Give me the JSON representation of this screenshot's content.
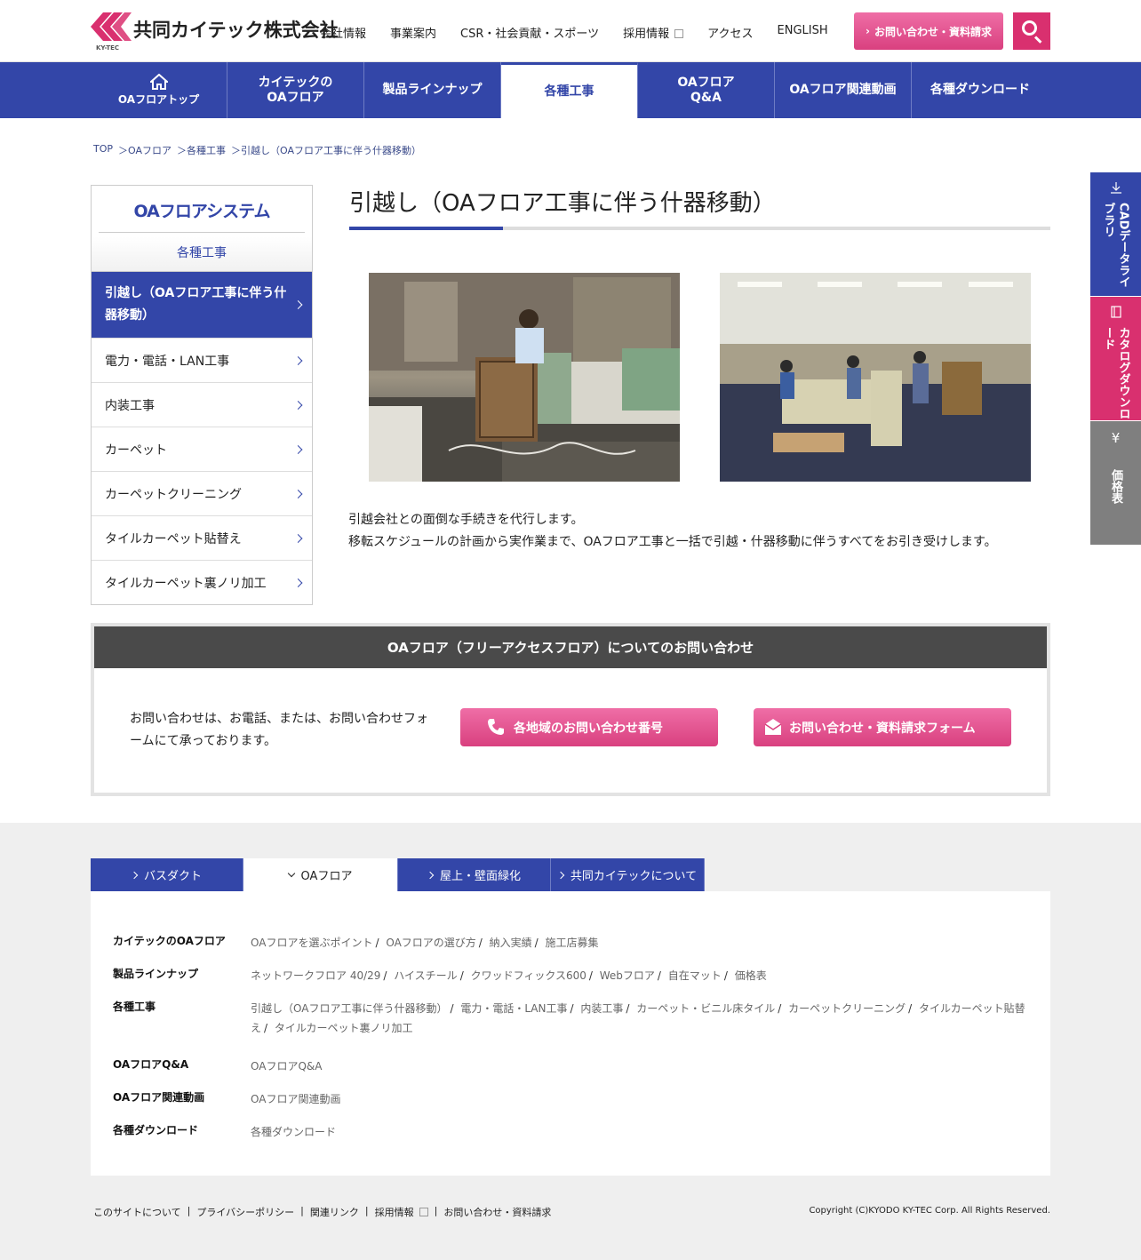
{
  "header": {
    "logo_text": "共同カイテック株式会社",
    "logo_sub": "KY-TEC",
    "nav": [
      "会社情報",
      "事業案内",
      "CSR・社会貢献・スポーツ",
      "採用情報",
      "アクセス",
      "ENGLISH"
    ],
    "contact_label": "お問い合わせ・資料請求"
  },
  "mainnav": {
    "items": [
      {
        "label": "OAフロアトップ"
      },
      {
        "label": "カイテックの\nOAフロア"
      },
      {
        "label": "製品ラインナップ"
      },
      {
        "label": "各種工事"
      },
      {
        "label": "OAフロア\nQ&A"
      },
      {
        "label": "OAフロア関連動画"
      },
      {
        "label": "各種ダウンロード"
      }
    ]
  },
  "breadcrumb": [
    "TOP",
    "＞OAフロア",
    "＞各種工事",
    "＞引越し（OAフロア工事に伴う什器移動）"
  ],
  "sidebar": {
    "title": "OAフロアシステム",
    "subtitle": "各種工事",
    "items": [
      "引越し（OAフロア工事に伴う什器移動）",
      "電力・電話・LAN工事",
      "内装工事",
      "カーペット",
      "カーペットクリーニング",
      "タイルカーペット貼替え",
      "タイルカーペット裏ノリ加工"
    ]
  },
  "content": {
    "title": "引越し（OAフロア工事に伴う什器移動）",
    "desc_1": "引越会社との面倒な手続きを代行します。",
    "desc_2": "移転スケジュールの計画から実作業まで、OAフロア工事と一括で引越・什器移動に伴うすべてをお引き受けします。"
  },
  "inquiry": {
    "heading": "OAフロア（フリーアクセスフロア）についてのお問い合わせ",
    "text": "お問い合わせは、お電話、または、お問い合わせフォームにて承っております。",
    "btn_phone": "各地域のお問い合わせ番号",
    "btn_form": "お問い合わせ・資料請求フォーム"
  },
  "side_tabs": [
    "CADデータライブラリ",
    "カタログダウンロード",
    "価格表"
  ],
  "footer": {
    "tabs": [
      "バスダクト",
      "OAフロア",
      "屋上・壁面緑化",
      "共同カイテックについて"
    ],
    "rows": [
      {
        "label": "カイテックのOAフロア",
        "links": [
          "OAフロアを選ぶポイント",
          "OAフロアの選び方",
          "納入実績",
          "施工店募集"
        ]
      },
      {
        "label": "製品ラインナップ",
        "links": [
          "ネットワークフロア 40/29",
          "ハイスチール",
          "クワッドフィックス600",
          "Webフロア",
          "自在マット",
          "価格表"
        ]
      },
      {
        "label": "各種工事",
        "links": [
          "引越し（OAフロア工事に伴う什器移動）",
          "電力・電話・LAN工事",
          "内装工事",
          "カーペット・ビニル床タイル",
          "カーペットクリーニング",
          "タイルカーペット貼替え",
          "タイルカーペット裏ノリ加工"
        ]
      },
      {
        "label": "OAフロアQ&A",
        "links": [
          "OAフロアQ&A"
        ]
      },
      {
        "label": "OAフロア関連動画",
        "links": [
          "OAフロア関連動画"
        ]
      },
      {
        "label": "各種ダウンロード",
        "links": [
          "各種ダウンロード"
        ]
      }
    ],
    "bottom_links": [
      "このサイトについて",
      "プライバシーポリシー",
      "関連リンク",
      "採用情報",
      "お問い合わせ・資料請求"
    ],
    "copyright": "Copyright (C)KYODO KY-TEC Corp. All Rights Reserved."
  },
  "colors": {
    "brand_blue": "#3346a8",
    "brand_pink": "#d9306f"
  }
}
